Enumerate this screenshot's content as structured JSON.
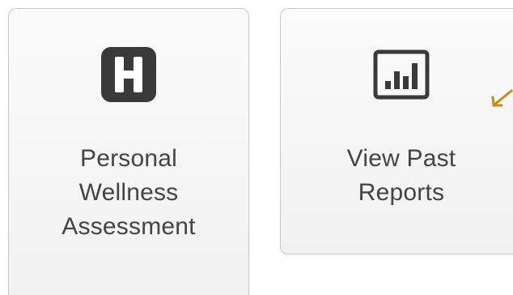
{
  "cards": [
    {
      "id": "wellness",
      "icon": "hospital-h-icon",
      "label_lines": [
        "Personal",
        "Wellness",
        "Assessment"
      ]
    },
    {
      "id": "reports",
      "icon": "bar-chart-icon",
      "label_lines": [
        "View Past",
        "Reports"
      ]
    }
  ],
  "colors": {
    "icon": "#3a3a3a",
    "label": "#444444",
    "card_border": "#c9c9c9",
    "arrow": "#c98a1a"
  },
  "decorations": {
    "arrow_icon": "pointer-arrow-icon"
  }
}
